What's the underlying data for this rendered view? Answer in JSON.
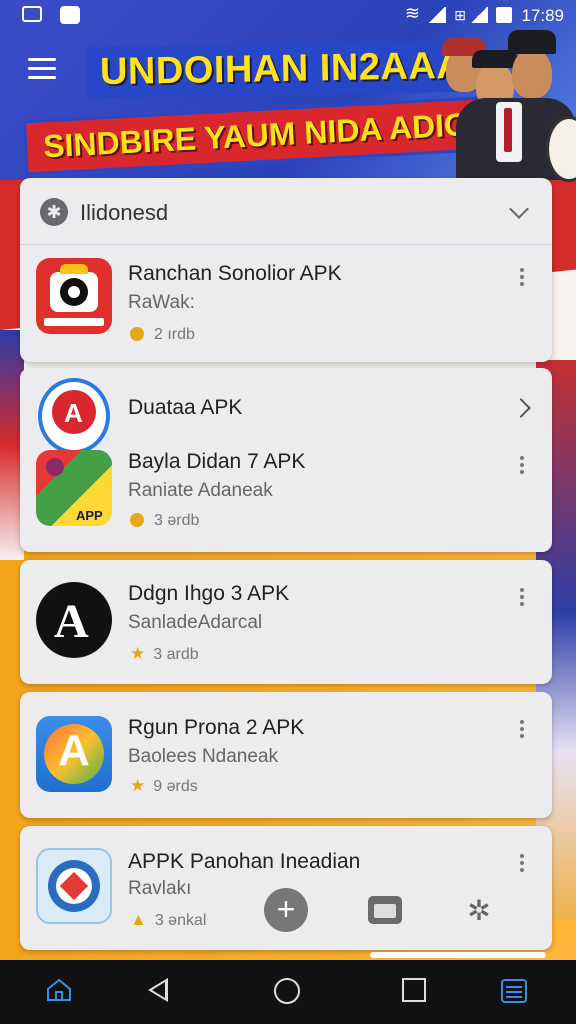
{
  "status_bar": {
    "time": "17:89"
  },
  "header": {
    "line1": "UNDOIHAN IN2AAA",
    "line2": "SINDBIRE YAUM NIDA ADIG!"
  },
  "country_selector": {
    "label": "Ilidonesd"
  },
  "apps": [
    {
      "title": "Ranchan Sonolior APK",
      "subtitle": "RaWak:",
      "meta": "2 ırdb",
      "meta_icon": "dot"
    },
    {
      "title": "Duataa APK",
      "subtitle": "",
      "meta": "",
      "meta_icon": "arrow"
    },
    {
      "title": "Bayla Didan 7 APK",
      "subtitle": "Raniate Adaneak",
      "meta": "3 ərdb",
      "meta_icon": "dot"
    },
    {
      "title": "Ddgn Ihgo 3 APK",
      "subtitle": "SanladeAdarcal",
      "meta": "3 ardb",
      "meta_icon": "star"
    },
    {
      "title": "Rgun Prona 2 APK",
      "subtitle": "Baolees Ndaneak",
      "meta": "9 ərds",
      "meta_icon": "star"
    },
    {
      "title": "APPK Panohan Ineadian",
      "subtitle": "Ravlakı",
      "meta": "3 ənkal",
      "meta_icon": "warn"
    }
  ],
  "app_icon_texts": {
    "icon2_badge": "APP"
  },
  "colors": {
    "accent": "#e6a817",
    "nav_active": "#3b8ee8",
    "card_bg": "#ecebee"
  }
}
